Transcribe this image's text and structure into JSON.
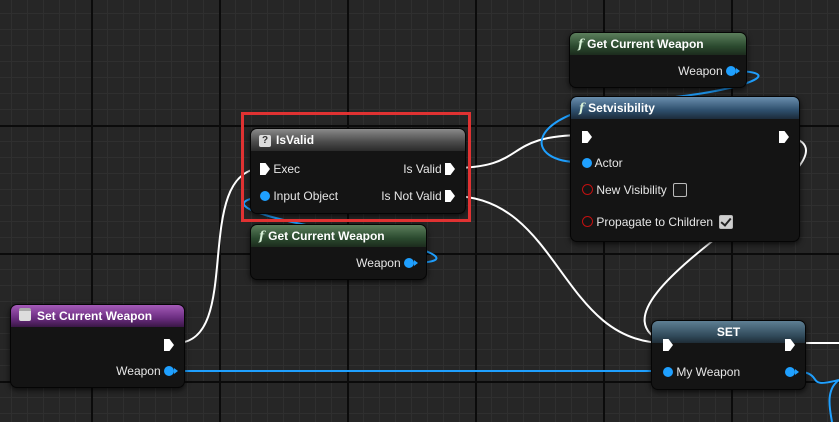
{
  "nodes": {
    "get_weapon_top": {
      "title": "Get Current Weapon",
      "output": "Weapon"
    },
    "set_visibility": {
      "title": "Setvisibility",
      "inputs": {
        "actor": "Actor",
        "new_visibility": "New Visibility",
        "propagate": "Propagate to Children"
      },
      "new_visibility_checked": false,
      "propagate_checked": true
    },
    "is_valid": {
      "title": "IsValid",
      "inputs": {
        "exec": "Exec",
        "input_object": "Input Object"
      },
      "outputs": {
        "is_valid": "Is Valid",
        "is_not_valid": "Is Not Valid"
      }
    },
    "get_weapon_mid": {
      "title": "Get Current Weapon",
      "output": "Weapon"
    },
    "set_current_weapon": {
      "title": "Set Current Weapon",
      "output": "Weapon"
    },
    "set": {
      "title": "SET",
      "input": "My Weapon"
    }
  },
  "colors": {
    "exec_wire": "#ffffff",
    "object_wire": "#1fa0ff",
    "highlight": "#e03232"
  }
}
